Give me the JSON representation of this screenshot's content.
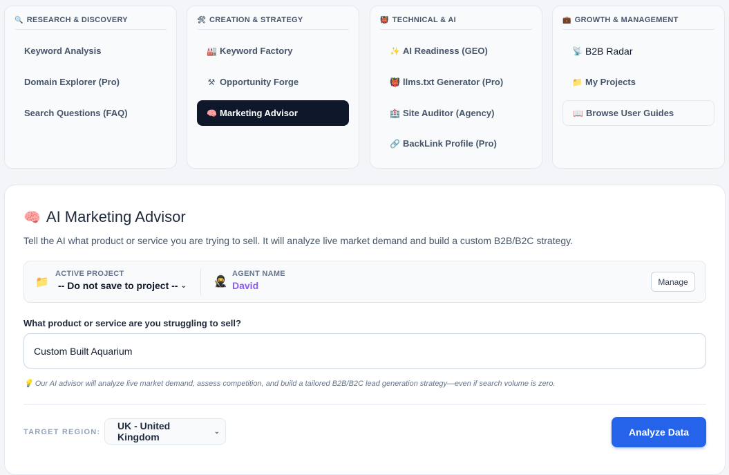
{
  "nav": {
    "research": {
      "icon": "🔍",
      "heading": "RESEARCH & DISCOVERY",
      "items": [
        {
          "label": "Keyword Analysis"
        },
        {
          "label": "Domain Explorer (Pro)"
        },
        {
          "label": "Search Questions (FAQ)"
        }
      ]
    },
    "creation": {
      "icon": "🛠",
      "heading": "CREATION & STRATEGY",
      "items": [
        {
          "icon": "🏭",
          "label": "Keyword Factory"
        },
        {
          "icon": "⚒",
          "label": "Opportunity Forge"
        },
        {
          "icon": "🧠",
          "label": "Marketing Advisor"
        }
      ]
    },
    "technical": {
      "icon": "👹",
      "heading": "TECHNICAL & AI",
      "items": [
        {
          "icon": "✨",
          "label": "AI Readiness (GEO)"
        },
        {
          "icon": "👹",
          "label": "llms.txt Generator (Pro)"
        },
        {
          "icon": "🏥",
          "label": "Site Auditor (Agency)"
        },
        {
          "icon": "🔗",
          "label": "BackLink Profile (Pro)"
        }
      ]
    },
    "growth": {
      "icon": "💼",
      "heading": "GROWTH & MANAGEMENT",
      "items": [
        {
          "icon": "📡",
          "label": "B2B Radar"
        },
        {
          "icon": "📁",
          "label": "My Projects"
        },
        {
          "icon": "📖",
          "label": "Browse User Guides"
        }
      ]
    }
  },
  "main": {
    "title_icon": "🧠",
    "title": "AI Marketing Advisor",
    "subtitle": "Tell the AI what product or service you are trying to sell. It will analyze live market demand and build a custom B2B/B2C strategy.",
    "project": {
      "folder_icon": "📁",
      "label": "ACTIVE PROJECT",
      "selected": "-- Do not save to project --",
      "chevron": "⌄"
    },
    "agent": {
      "icon": "🥷",
      "label": "AGENT NAME",
      "name": "David"
    },
    "manage_label": "Manage",
    "field_label": "What product or service are you struggling to sell?",
    "input_value": "Custom Built Aquarium",
    "hint_icon": "💡",
    "hint": "Our AI advisor will analyze live market demand, assess competition, and build a tailored B2B/B2C lead generation strategy—even if search volume is zero.",
    "region_label": "TARGET REGION:",
    "region_selected": "UK - United Kingdom",
    "region_chevron": "⌄",
    "analyze_label": "Analyze Data"
  }
}
